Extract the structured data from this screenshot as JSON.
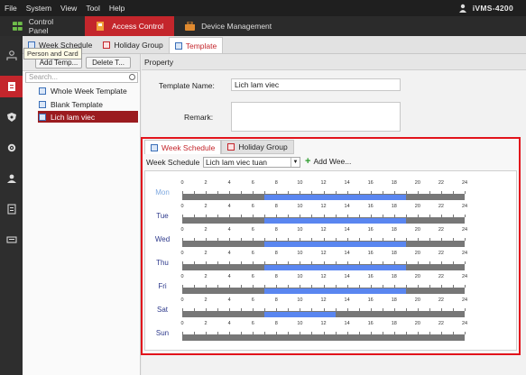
{
  "menu": {
    "items": [
      "File",
      "System",
      "View",
      "Tool",
      "Help"
    ],
    "app_title": "iVMS-4200"
  },
  "modules": [
    {
      "label": "Control Panel",
      "icon": "grid-icon"
    },
    {
      "label": "Access Control",
      "icon": "access-control-icon"
    },
    {
      "label": "Device Management",
      "icon": "toolbox-icon"
    }
  ],
  "subtabs": [
    "Week Schedule",
    "Holiday Group",
    "Template"
  ],
  "tooltip": "Person and Card",
  "left": {
    "add_label": "Add Temp...",
    "delete_label": "Delete T...",
    "search_placeholder": "Search...",
    "templates": [
      "Whole Week Template",
      "Blank Template",
      "Lich lam viec"
    ],
    "selected_index": 2
  },
  "property": {
    "header": "Property",
    "name_label": "Template Name:",
    "name_value": "Lich lam viec",
    "remark_label": "Remark:",
    "remark_value": ""
  },
  "schedule": {
    "tabs": [
      "Week Schedule",
      "Holiday Group"
    ],
    "week_label": "Week Schedule",
    "week_value": "Lich lam viec tuan",
    "add_label": "Add Wee...",
    "hour_ticks": [
      "0",
      "2",
      "4",
      "6",
      "8",
      "10",
      "12",
      "14",
      "16",
      "18",
      "20",
      "22",
      "24"
    ],
    "days": [
      {
        "name": "Mon",
        "start": 7,
        "end": 19
      },
      {
        "name": "Tue",
        "start": 7,
        "end": 19
      },
      {
        "name": "Wed",
        "start": 7,
        "end": 19
      },
      {
        "name": "Thu",
        "start": 7,
        "end": 19
      },
      {
        "name": "Fri",
        "start": 7,
        "end": 19
      },
      {
        "name": "Sat",
        "start": 7,
        "end": 13
      },
      {
        "name": "Sun",
        "start": null,
        "end": null
      }
    ]
  },
  "colors": {
    "accent": "#c4262c",
    "highlight": "#e2141c",
    "bar_fill": "#5a86f0",
    "bar_track": "#777777"
  }
}
